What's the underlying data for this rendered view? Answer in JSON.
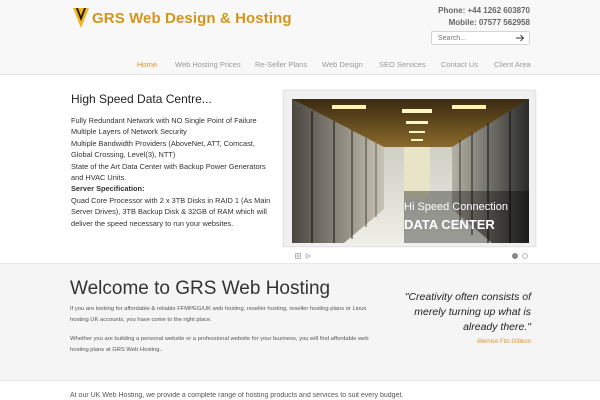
{
  "brand": {
    "name": "GRS Web Design & Hosting",
    "logo_color": "#d4951c"
  },
  "contact": {
    "phone": "Phone: +44 1262 603870",
    "mobile": "Mobile: 07577 562958"
  },
  "search": {
    "placeholder": "Search..."
  },
  "nav": {
    "items": [
      {
        "label": "Home",
        "active": true
      },
      {
        "label": "Web Hosting Prices"
      },
      {
        "label": "Re-Seller Plans"
      },
      {
        "label": "Web Design"
      },
      {
        "label": "SEO Services"
      },
      {
        "label": "Contact Us"
      },
      {
        "label": "Client Area"
      }
    ],
    "active_color": "#e0932a"
  },
  "hero": {
    "title": "High Speed Data Centre...",
    "lines": [
      "Fully Redundant Network with NO Single Point of Failure",
      "Multiple Layers of Network Security",
      "Multiple Bandwidth Providers (AboveNet, ATT, Comcast, Global Crossing, Level(3), NTT)",
      "State of the Art Data Center with Backup Power Generators and HVAC Units."
    ],
    "spec_label": "Server Specification:",
    "spec_text": "Quad Core Processor with 2 x 3TB Disks in RAID 1 (As Main Server Drives), 3TB Backup Disk & 32GB of RAM which will deliver the speed necessary to run your websites."
  },
  "slider": {
    "caption_line1": "Hi Speed Connection",
    "caption_line2": "DATA CENTER",
    "slide_count": 2,
    "active_slide": 1
  },
  "welcome": {
    "title": "Welcome to GRS Web Hosting",
    "p1": "If you are looking for affordable & reliable FFMPEG/UK web hosting, reseller hosting, reseller hosting plans or Linux hosting UK accounts, you have come to the right place.",
    "p2": "Whether you are building a personal website or a professional website for your business, you will find affordable web hosting plans at GRS Web Hosting.."
  },
  "quote": {
    "text": "\"Creativity often consists of merely turning up what is already there.\"",
    "author": "-Bernice Fitz-Gibbon"
  },
  "bottom": {
    "text": "At our UK Web Hosting, we provide a complete range of hosting products and services to suit every budget."
  }
}
